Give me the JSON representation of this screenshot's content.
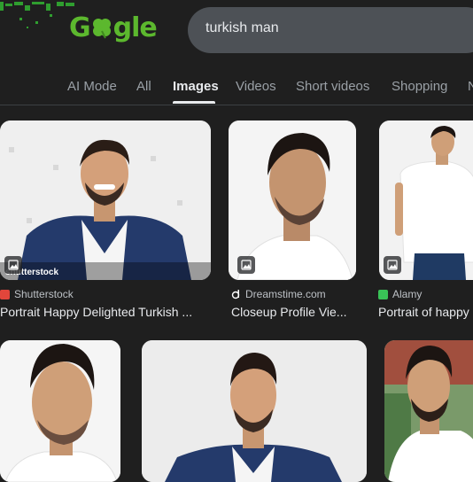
{
  "header": {
    "logo_text": "Gogle",
    "search_query": "turkish man"
  },
  "tabs": [
    {
      "label": "AI Mode",
      "active": false
    },
    {
      "label": "All",
      "active": false
    },
    {
      "label": "Images",
      "active": true
    },
    {
      "label": "Videos",
      "active": false
    },
    {
      "label": "Short videos",
      "active": false
    },
    {
      "label": "Shopping",
      "active": false
    },
    {
      "label": "N",
      "active": false
    }
  ],
  "results": [
    {
      "source": "Shutterstock",
      "favicon_color": "#e2463b",
      "title": "Portrait Happy Delighted Turkish ...",
      "watermark": "shutterstock"
    },
    {
      "source": "Dreamstime.com",
      "favicon_color": "#ffffff",
      "title": "Closeup Profile Vie..."
    },
    {
      "source": "Alamy",
      "favicon_color": "#39c257",
      "title": "Portrait of happy"
    }
  ],
  "colors": {
    "background": "#1f1f1f",
    "search_bg": "#4d5156",
    "logo_green": "#5cb82e"
  },
  "icons": [
    "clover-icon",
    "image-badge-icon"
  ]
}
